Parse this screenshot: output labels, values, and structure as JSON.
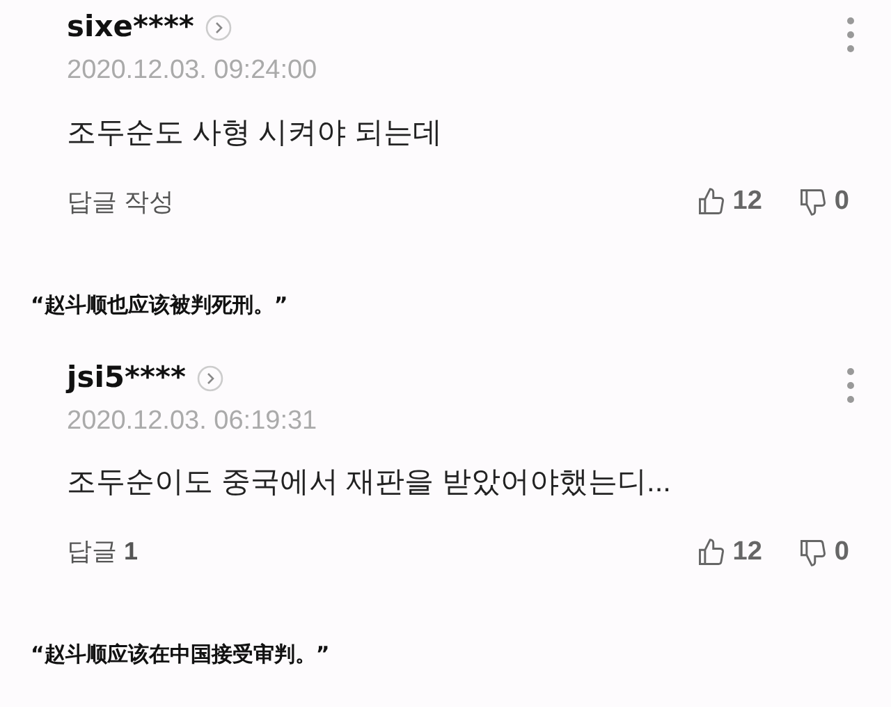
{
  "comments": [
    {
      "user": "sixe****",
      "date": "2020.12.03. 09:24:00",
      "text": "조두순도 사형 시켜야 되는데",
      "reply": "답글 작성",
      "likes": "12",
      "dislikes": "0",
      "caption": "“赵斗顺也应该被判死刑。”"
    },
    {
      "user": "jsi5****",
      "date": "2020.12.03. 06:19:31",
      "text": "조두순이도 중국에서 재판을 받았어야했는디...",
      "reply": "답글 **1**",
      "likes": "12",
      "dislikes": "0",
      "caption": "“赵斗顺应该在中国接受审判。”"
    }
  ]
}
